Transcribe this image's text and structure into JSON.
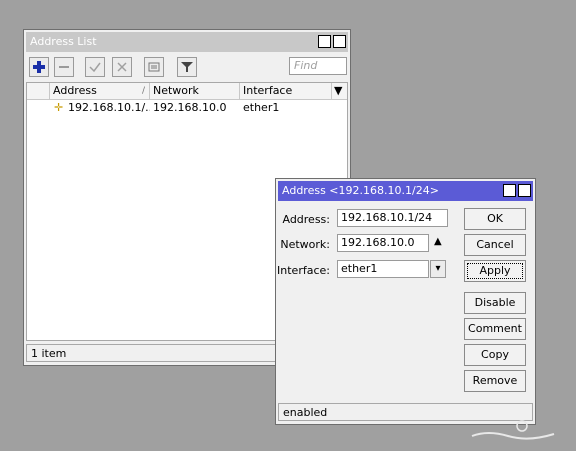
{
  "address_list": {
    "title": "Address List",
    "toolbar": {
      "add_icon": "plus-icon",
      "remove_icon": "minus-icon",
      "enable_icon": "check-icon",
      "disable_icon": "x-icon",
      "comment_icon": "note-icon",
      "filter_icon": "filter-icon",
      "find_placeholder": "Find"
    },
    "columns": [
      "Address",
      "Network",
      "Interface"
    ],
    "rows": [
      {
        "address": "192.168.10.1/...",
        "network": "192.168.10.0",
        "interface": "ether1"
      }
    ],
    "status": "1 item"
  },
  "address_dialog": {
    "title": "Address <192.168.10.1/24>",
    "fields": {
      "address_label": "Address:",
      "address_value": "192.168.10.1/24",
      "network_label": "Network:",
      "network_value": "192.168.10.0",
      "interface_label": "Interface:",
      "interface_value": "ether1"
    },
    "buttons": {
      "ok": "OK",
      "cancel": "Cancel",
      "apply": "Apply",
      "disable": "Disable",
      "comment": "Comment",
      "copy": "Copy",
      "remove": "Remove"
    },
    "status": "enabled"
  },
  "colors": {
    "desktop": "#a0a0a0",
    "active_titlebar": "#5b5bd6",
    "inactive_titlebar": "#c8c8c8"
  }
}
